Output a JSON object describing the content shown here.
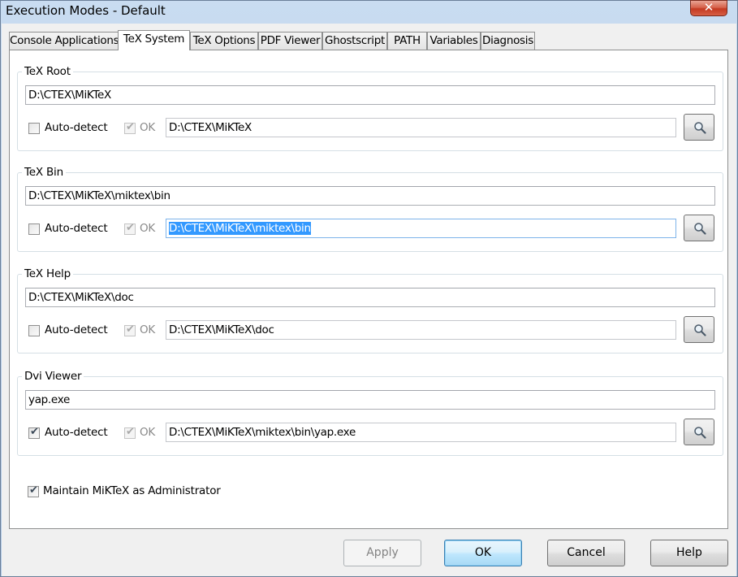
{
  "window": {
    "title": "Execution Modes - Default",
    "close_icon": "close-icon"
  },
  "tabs": [
    {
      "label": "Console Applications",
      "active": false
    },
    {
      "label": "TeX System",
      "active": true
    },
    {
      "label": "TeX Options",
      "active": false
    },
    {
      "label": "PDF Viewer",
      "active": false
    },
    {
      "label": "Ghostscript",
      "active": false
    },
    {
      "label": "PATH",
      "active": false
    },
    {
      "label": "Variables",
      "active": false
    },
    {
      "label": "Diagnosis",
      "active": false
    }
  ],
  "groups": {
    "tex_root": {
      "title": "TeX Root",
      "value": "D:\\CTEX\\MiKTeX",
      "auto_detect_label": "Auto-detect",
      "auto_detect_checked": false,
      "ok_label": "OK",
      "ok_checked": true,
      "detected_path": "D:\\CTEX\\MiKTeX"
    },
    "tex_bin": {
      "title": "TeX Bin",
      "value": "D:\\CTEX\\MiKTeX\\miktex\\bin",
      "auto_detect_label": "Auto-detect",
      "auto_detect_checked": false,
      "ok_label": "OK",
      "ok_checked": true,
      "detected_path": "D:\\CTEX\\MiKTeX\\miktex\\bin"
    },
    "tex_help": {
      "title": "TeX Help",
      "value": "D:\\CTEX\\MiKTeX\\doc",
      "auto_detect_label": "Auto-detect",
      "auto_detect_checked": false,
      "ok_label": "OK",
      "ok_checked": true,
      "detected_path": "D:\\CTEX\\MiKTeX\\doc"
    },
    "dvi_viewer": {
      "title": "Dvi Viewer",
      "value": "yap.exe",
      "auto_detect_label": "Auto-detect",
      "auto_detect_checked": true,
      "ok_label": "OK",
      "ok_checked": true,
      "detected_path": "D:\\CTEX\\MiKTeX\\miktex\\bin\\yap.exe"
    }
  },
  "admin": {
    "label": "Maintain MiKTeX as Administrator",
    "checked": true
  },
  "buttons": {
    "apply": "Apply",
    "ok": "OK",
    "cancel": "Cancel",
    "help": "Help"
  },
  "icons": {
    "browse": "search-icon",
    "check": "checkmark-icon"
  }
}
